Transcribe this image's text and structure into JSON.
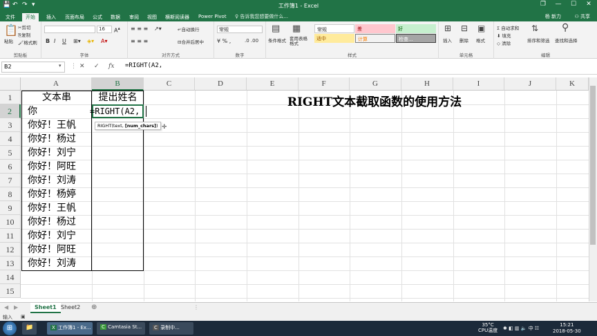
{
  "window": {
    "title": "工作簿1 - Excel",
    "user": "杨 新力",
    "share": "共享",
    "min": "—",
    "max": "☐",
    "close": "✕",
    "restore": "❐"
  },
  "quick_access": {
    "save": "💾",
    "undo": "↶",
    "redo": "↷",
    "customize": "▾"
  },
  "ribbon_tabs": [
    "文件",
    "开始",
    "插入",
    "页面布局",
    "公式",
    "数据",
    "审阅",
    "视图",
    "横斯阅读器",
    "Power Pivot"
  ],
  "active_tab": "开始",
  "tell_me": "告诉我您想要做什么...",
  "ribbon": {
    "clipboard": {
      "label": "剪贴板",
      "paste": "粘贴",
      "cut": "剪切",
      "copy": "复制",
      "painter": "格式刷"
    },
    "font": {
      "label": "字体",
      "size": "16",
      "bold": "B",
      "italic": "I",
      "underline": "U"
    },
    "alignment": {
      "label": "对齐方式",
      "wrap": "自动换行",
      "merge": "合并后居中"
    },
    "number": {
      "label": "数字",
      "format": "常规"
    },
    "styles": {
      "label": "样式",
      "conditional": "条件格式",
      "table": "套用表格格式",
      "items": [
        "常规",
        "差",
        "好",
        "适中",
        "计算",
        "检查..."
      ]
    },
    "cells": {
      "label": "单元格",
      "insert": "插入",
      "delete": "删除",
      "format": "格式"
    },
    "editing": {
      "label": "编辑",
      "autosum": "自动求和",
      "fill": "填充",
      "clear": "清除",
      "sort": "排序和筛选",
      "find": "查找和选择"
    }
  },
  "formula_bar": {
    "name_box": "B2",
    "cancel": "✕",
    "enter": "✓",
    "fx": "fx",
    "formula": "=RIGHT(A2,"
  },
  "columns": [
    "A",
    "B",
    "C",
    "D",
    "E",
    "F",
    "G",
    "H",
    "I",
    "J",
    "K"
  ],
  "rows": [
    "1",
    "2",
    "3",
    "4",
    "5",
    "6",
    "7",
    "8",
    "9",
    "10",
    "11",
    "12",
    "13",
    "14",
    "15"
  ],
  "cells": {
    "A1": "文本串",
    "B1": "提出姓名",
    "A2": "你",
    "B2": "=RIGHT(A2,",
    "A3": "你好！王帆",
    "A4": "你好！杨过",
    "A5": "你好！刘宁",
    "A6": "你好！阿旺",
    "A7": "你好！刘涛",
    "A8": "你好！杨婷",
    "A9": "你好！王帆",
    "A10": "你好！杨过",
    "A11": "你好！刘宁",
    "A12": "你好！阿旺",
    "A13": "你好！刘涛",
    "title": "RIGHT文本截取函数的使用方法"
  },
  "tooltip": {
    "prefix": "RIGHT(text, ",
    "bold": "[num_chars]",
    "suffix": ")"
  },
  "sheets": [
    "Sheet1",
    "Sheet2"
  ],
  "active_sheet": "Sheet1",
  "add_sheet": "⊕",
  "status": {
    "mode": "输入"
  },
  "taskbar": {
    "items": [
      "工作簿1 - Ex...",
      "Camtasia St...",
      "录制中..."
    ],
    "temp": "35°C",
    "cpu": "CPU温度",
    "time": "15:21",
    "date": "2018-05-30"
  }
}
